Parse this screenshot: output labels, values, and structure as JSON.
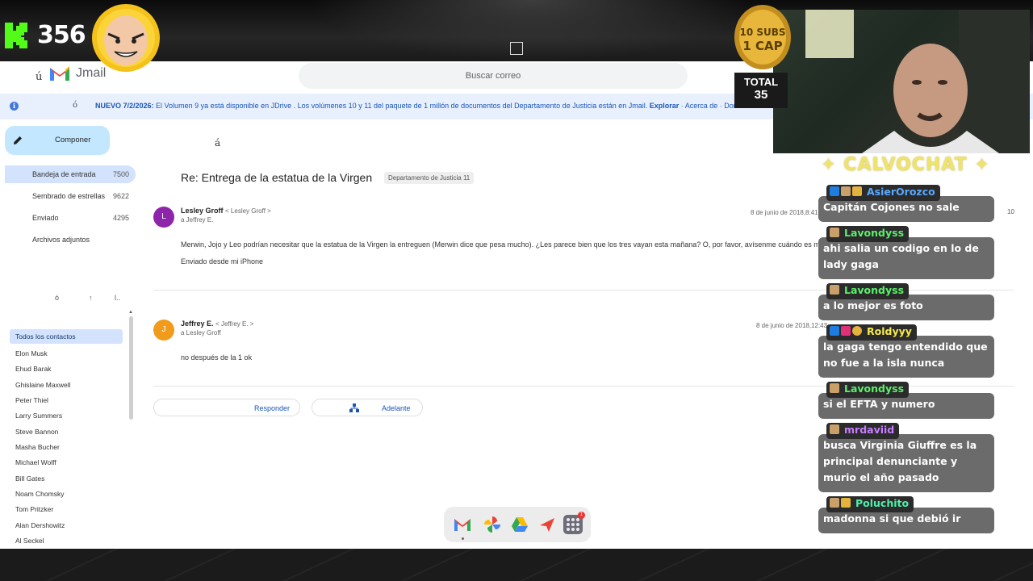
{
  "stream": {
    "viewer_count": "356",
    "coin_label": "10 SUBS 1 CAP",
    "total_label": "TOTAL",
    "total_value": "35",
    "chat_title": "✦ CALVOCHAT ✦"
  },
  "app": {
    "stray_glyph": "ú",
    "brand": "Jmail",
    "search_placeholder": "Buscar correo"
  },
  "notice": {
    "glyph": "ó",
    "bold_prefix": "NUEVO 7/2/2026:",
    "text": " El Volumen 9 ya está disponible en JDrive . Los volúmenes 10 y 11 del paquete de 1 millón de documentos del Departamento de Justicia están en Jmail. ",
    "explore": "Explorar",
    "extra": "  ·  Acerca de  ·  Donar"
  },
  "sidebar": {
    "compose_label": "Componer",
    "items": [
      {
        "label": "Bandeja de entrada",
        "count": "7500"
      },
      {
        "label": "Sembrado de estrellas",
        "count": "9622"
      },
      {
        "label": "Enviado",
        "count": "4295"
      },
      {
        "label": "Archivos adjuntos",
        "count": ""
      }
    ],
    "mini_icons": [
      "ó",
      "↑",
      "l.."
    ],
    "contacts_header": "Todos los contactos",
    "contacts": [
      "Elon Musk",
      "Ehud Barak",
      "Ghislaine Maxwell",
      "Peter Thiel",
      "Larry Summers",
      "Steve Bannon",
      "Masha Bucher",
      "Michael Wolff",
      "Bill Gates",
      "Noam Chomsky",
      "Tom Pritzker",
      "Alan Dershowitz",
      "Al Seckel"
    ]
  },
  "email": {
    "accent_glyph": "á",
    "subject": "Re: Entrega de la estatua de la Virgen",
    "tag": "Departamento de Justicia 11",
    "side_number": "10",
    "messages": [
      {
        "avatar_letter": "L",
        "avatar_color": "#8e24aa",
        "sender_name": "Lesley Groff",
        "sender_addr": "< Lesley Groff >",
        "to": "a Jeffrey E.",
        "date": "8 de junio de 2018,8:41",
        "body": "Merwin, Jojo y Leo podrían necesitar que la estatua de la Virgen la entreguen (Merwin dice que pesa mucho). ¿Les parece bien que los tres vayan esta mañana? O, por favor, avísenme cuándo es mejor que vayan.",
        "signature": "Enviado desde mi iPhone"
      },
      {
        "avatar_letter": "J",
        "avatar_color": "#f09b1b",
        "sender_name": "Jeffrey E.",
        "sender_addr": "< Jeffrey E. >",
        "to": "a Lesley Groff",
        "date": "8 de junio de 2018,12:43",
        "body": "no después de la 1 ok",
        "signature": ""
      }
    ],
    "reply_label": "Responder",
    "forward_label": "Adelante"
  },
  "dock": {
    "icons": [
      "jmail-icon",
      "photos-icon",
      "drive-icon",
      "flights-icon",
      "apps-grid-icon"
    ],
    "badge": "1"
  },
  "chat": [
    {
      "user": "AsierOrozco",
      "user_color": "#5aa9ff",
      "text": "Capitán Cojones no sale"
    },
    {
      "user": "Lavondyss",
      "user_color": "#5bf06a",
      "text": "ahi salia un codigo en lo de lady gaga"
    },
    {
      "user": "Lavondyss",
      "user_color": "#5bf06a",
      "text": "a lo mejor es foto"
    },
    {
      "user": "Roldyyy",
      "user_color": "#f6ea4a",
      "text": "la gaga tengo entendido que no fue a la isla nunca"
    },
    {
      "user": "Lavondyss",
      "user_color": "#5bf06a",
      "text": "si el EFTA y numero"
    },
    {
      "user": "mrdaviid",
      "user_color": "#c77dff",
      "text": "busca Virginia Giuffre es la principal denunciante y murio el año pasado"
    },
    {
      "user": "Poluchito",
      "user_color": "#4cf0a8",
      "text": "madonna si que debió ir"
    }
  ]
}
